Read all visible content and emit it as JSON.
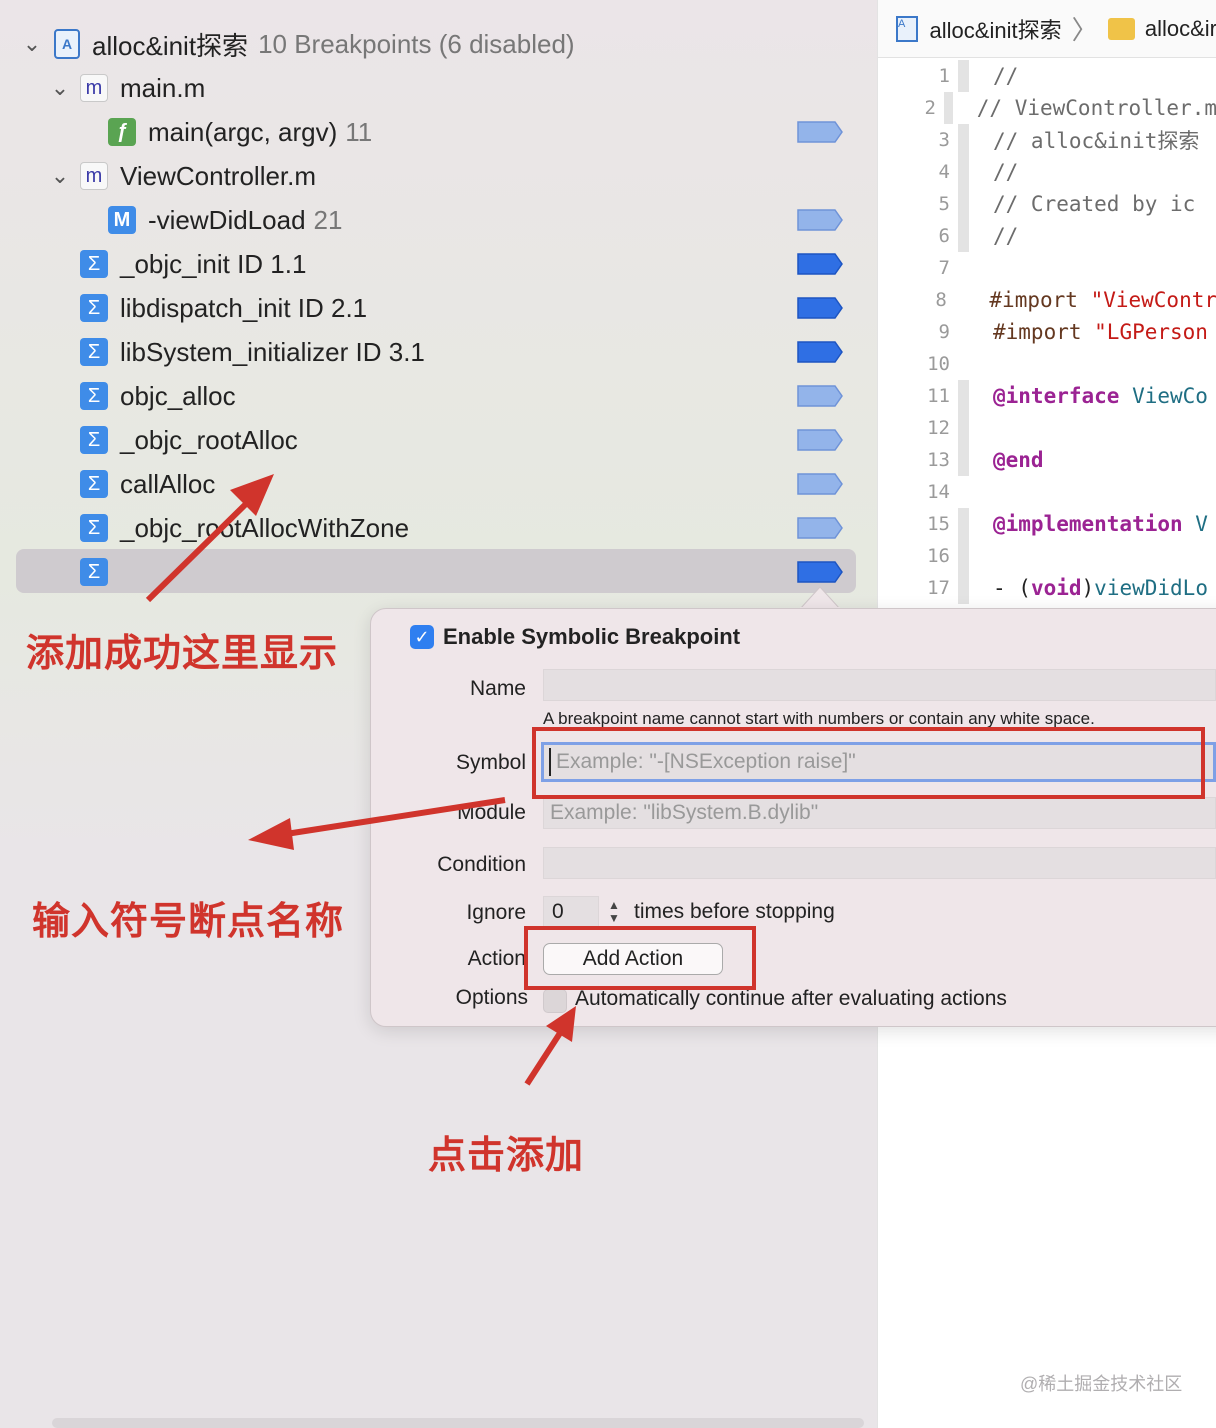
{
  "navigator": {
    "project": {
      "name": "alloc&init探索",
      "summary": "10 Breakpoints (6 disabled)"
    },
    "files": [
      {
        "name": "main.m",
        "icon": "m",
        "method": {
          "icon": "ƒ",
          "label": "main(argc, argv)",
          "line": "11",
          "enabled": false
        }
      },
      {
        "name": "ViewController.m",
        "icon": "m",
        "method": {
          "icon": "M",
          "label": "-viewDidLoad",
          "line": "21",
          "enabled": false
        }
      }
    ],
    "symbols": [
      {
        "label": "_objc_init  ID 1.1",
        "enabled": true
      },
      {
        "label": "libdispatch_init  ID 2.1",
        "enabled": true
      },
      {
        "label": "libSystem_initializer  ID 3.1",
        "enabled": true
      },
      {
        "label": "objc_alloc",
        "enabled": false
      },
      {
        "label": "_objc_rootAlloc",
        "enabled": false
      },
      {
        "label": "callAlloc",
        "enabled": false
      },
      {
        "label": "_objc_rootAllocWithZone",
        "enabled": false
      },
      {
        "label": "",
        "enabled": true,
        "selected": true
      }
    ],
    "symbol_icon": "Σ"
  },
  "editor": {
    "breadcrumb": {
      "project": "alloc&init探索",
      "folder": "alloc&ir"
    },
    "lines": [
      {
        "n": "1",
        "text": "//",
        "cls": "c-comment",
        "fold": true
      },
      {
        "n": "2",
        "text": "//  ViewController.m",
        "cls": "c-comment",
        "fold": true
      },
      {
        "n": "3",
        "text": "//  alloc&init探索",
        "cls": "c-comment",
        "fold": true
      },
      {
        "n": "4",
        "text": "//",
        "cls": "c-comment",
        "fold": true
      },
      {
        "n": "5",
        "text": "//  Created by ic",
        "cls": "c-comment",
        "fold": true
      },
      {
        "n": "6",
        "text": "//",
        "cls": "c-comment",
        "fold": true
      },
      {
        "n": "7",
        "text": "",
        "cls": "c-plain",
        "fold": false
      },
      {
        "n": "8",
        "kw": "#import ",
        "str": "\"ViewContr",
        "fold": false,
        "import": true
      },
      {
        "n": "9",
        "kw": "#import ",
        "str": "\"LGPerson",
        "fold": false,
        "import": true
      },
      {
        "n": "10",
        "text": "",
        "cls": "c-plain",
        "fold": false
      },
      {
        "n": "11",
        "kw2": "@interface ",
        "type": "ViewCo",
        "fold": true
      },
      {
        "n": "12",
        "text": "",
        "cls": "c-plain",
        "fold": true
      },
      {
        "n": "13",
        "kw2": "@end",
        "type": "",
        "fold": true
      },
      {
        "n": "14",
        "text": "",
        "cls": "c-plain",
        "fold": false
      },
      {
        "n": "15",
        "kw2": "@implementation ",
        "type": "V",
        "fold": true
      },
      {
        "n": "16",
        "text": "",
        "cls": "c-plain",
        "fold": true
      },
      {
        "n": "17",
        "pre": "- (",
        "kw2": "void",
        "post": ")",
        "type": "viewDidLo",
        "fold": true
      }
    ]
  },
  "popover": {
    "enable_label": "Enable Symbolic Breakpoint",
    "enable_checked": true,
    "name_label": "Name",
    "name_hint": "A breakpoint name cannot start with numbers or contain any white space.",
    "symbol_label": "Symbol",
    "symbol_placeholder": "Example: \"-[NSException raise]\"",
    "module_label": "Module",
    "module_placeholder": "Example: \"libSystem.B.dylib\"",
    "condition_label": "Condition",
    "ignore_label": "Ignore",
    "ignore_value": "0",
    "times_label": "times before stopping",
    "action_label": "Action",
    "add_action": "Add Action",
    "options_label": "Options",
    "auto_continue_label": "Automatically continue after evaluating actions"
  },
  "annotations": {
    "added_shows_here": "添加成功这里显示",
    "enter_symbol_name": "输入符号断点名称",
    "click_to_add": "点击添加"
  },
  "watermark": "@稀土掘金技术社区",
  "colors": {
    "breakpoint_enabled": "#2f6fe4",
    "breakpoint_disabled": "#93b4ea",
    "annotation_red": "#d0342c",
    "accent": "#2f7ff0"
  }
}
